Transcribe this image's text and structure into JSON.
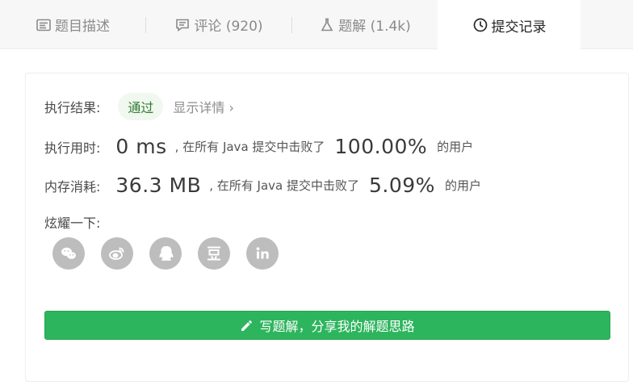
{
  "tabs": [
    {
      "label": "题目描述",
      "icon": "description-icon"
    },
    {
      "label": "评论 (920)",
      "icon": "comment-icon"
    },
    {
      "label": "题解 (1.4k)",
      "icon": "flask-icon"
    },
    {
      "label": "提交记录",
      "icon": "clock-icon",
      "active": true
    }
  ],
  "result": {
    "label": "执行结果:",
    "status": "通过",
    "details_link": "显示详情 ›"
  },
  "runtime": {
    "label": "执行用时:",
    "value": "0 ms",
    "mid_text": ", 在所有 Java 提交中击败了",
    "percent": "100.00%",
    "suffix": "的用户"
  },
  "memory": {
    "label": "内存消耗:",
    "value": "36.3 MB",
    "mid_text": ", 在所有 Java 提交中击败了",
    "percent": "5.09%",
    "suffix": "的用户"
  },
  "share": {
    "label": "炫耀一下:",
    "items": [
      "wechat-icon",
      "weibo-icon",
      "qq-icon",
      "douban-icon",
      "linkedin-icon"
    ]
  },
  "cta": {
    "label": "写题解，分享我的解题思路",
    "icon": "pencil-icon"
  },
  "colors": {
    "accent": "#2db55d",
    "badge_bg": "#f1f8ef",
    "badge_text": "#2e7d32",
    "share_gray": "#bdbdbd"
  }
}
